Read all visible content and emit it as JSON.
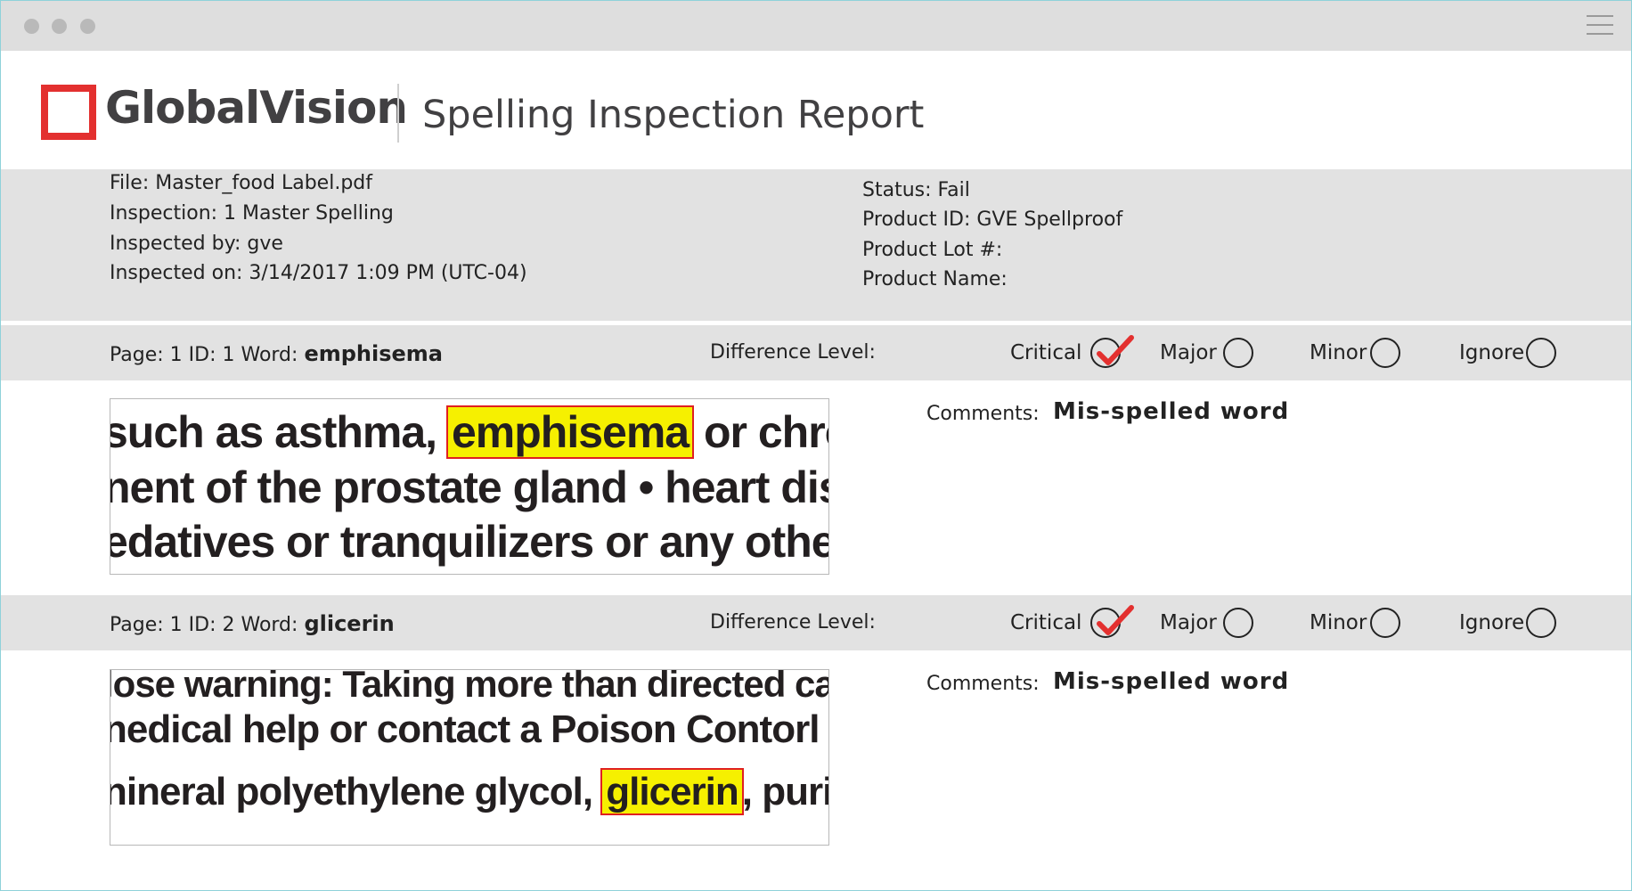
{
  "brand": {
    "name": "GlobalVision",
    "accent": "#e3302f"
  },
  "report": {
    "title": "Spelling Inspection Report"
  },
  "info": {
    "file": "File: Master_food Label.pdf",
    "inspection": "Inspection: 1 Master Spelling",
    "inspected_by": "Inspected by: gve",
    "inspected_on": "Inspected on: 3/14/2017 1:09 PM (UTC-04)",
    "status": "Status: Fail",
    "product_id": "Product ID: GVE Spellproof",
    "product_lot": "Product Lot #:",
    "product_name": "Product Name:"
  },
  "difference_label": "Difference Level:",
  "levels": {
    "critical": "Critical",
    "major": "Major",
    "minor": "Minor",
    "ignore": "Ignore"
  },
  "comments_label": "Comments:",
  "records": [
    {
      "prefix": "Page: 1 ID: 1 Word: ",
      "word": "emphisema",
      "selected_level": "Critical",
      "comment": "Mis-spelled word",
      "snippet": {
        "line1_before": "such as asthma, ",
        "line1_highlight": "emphisema",
        "line1_after": " or chronic",
        "line2": "nent of the prostate gland • heart disease",
        "line3": "edatives or tranquilizers or any other"
      }
    },
    {
      "prefix": "Page: 1 ID: 2 Word: ",
      "word": "glicerin",
      "selected_level": "Critical",
      "comment": "Mis-spelled word",
      "snippet": {
        "line1": "lose warning: Taking more than directed can caus",
        "line2": "nedical help or contact a Poison Contorl Center ri",
        "line3_before": "nineral polyethylene glycol, ",
        "line3_highlight": "glicerin",
        "line3_after": ", purified"
      }
    }
  ]
}
